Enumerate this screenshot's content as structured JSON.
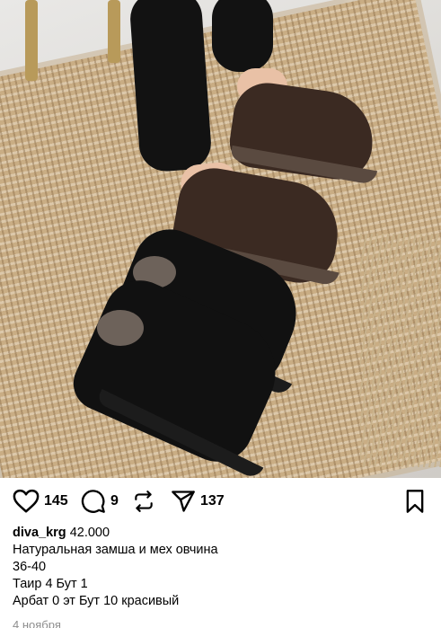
{
  "post": {
    "image_icon": "photo-of-suede-winter-shoes",
    "likes": "145",
    "comments": "9",
    "shares": "137",
    "username": "diva_krg",
    "caption_lines": [
      "42.000",
      "Натуральная замша и мех овчина",
      "36-40",
      "Таир 4 Бут 1",
      "Арбат 0 эт Бут 10 красивый"
    ],
    "date": "4 ноября"
  },
  "icons": {
    "like": "heart-icon",
    "comment": "comment-icon",
    "repost": "repost-icon",
    "share": "send-icon",
    "save": "bookmark-icon"
  }
}
